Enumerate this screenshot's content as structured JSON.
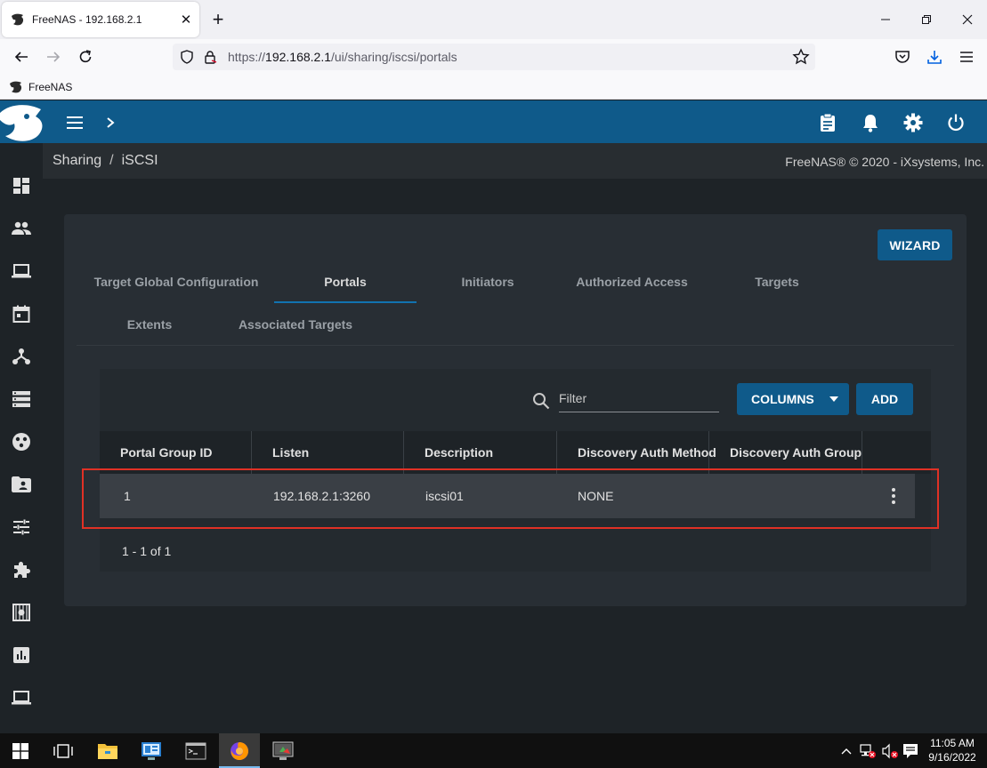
{
  "browser": {
    "tab_title": "FreeNAS - 192.168.2.1",
    "url_prefix": "https://",
    "url_host": "192.168.2.1",
    "url_path": "/ui/sharing/iscsi/portals",
    "bookmark": "FreeNAS"
  },
  "breadcrumb": {
    "parent": "Sharing",
    "separator": "/",
    "current": "iSCSI"
  },
  "copyright": "FreeNAS® © 2020 - iXsystems, Inc.",
  "wizard_label": "WIZARD",
  "tabs": [
    {
      "label": "Target Global Configuration"
    },
    {
      "label": "Portals"
    },
    {
      "label": "Initiators"
    },
    {
      "label": "Authorized Access"
    },
    {
      "label": "Targets"
    },
    {
      "label": "Extents"
    },
    {
      "label": "Associated Targets"
    }
  ],
  "toolbar": {
    "filter_placeholder": "Filter",
    "columns_label": "COLUMNS",
    "add_label": "ADD"
  },
  "table": {
    "columns": [
      "Portal Group ID",
      "Listen",
      "Description",
      "Discovery Auth Method",
      "Discovery Auth Group"
    ],
    "rows": [
      {
        "portal_group_id": "1",
        "listen": "192.168.2.1:3260",
        "description": "iscsi01",
        "discovery_auth_method": "NONE",
        "discovery_auth_group": ""
      }
    ],
    "pagination": "1 - 1 of 1"
  },
  "taskbar": {
    "time": "11:05 AM",
    "date": "9/16/2022"
  },
  "colors": {
    "brand": "#0f5a8a",
    "highlight": "#e03125",
    "tab_ink": "#1173b0"
  }
}
